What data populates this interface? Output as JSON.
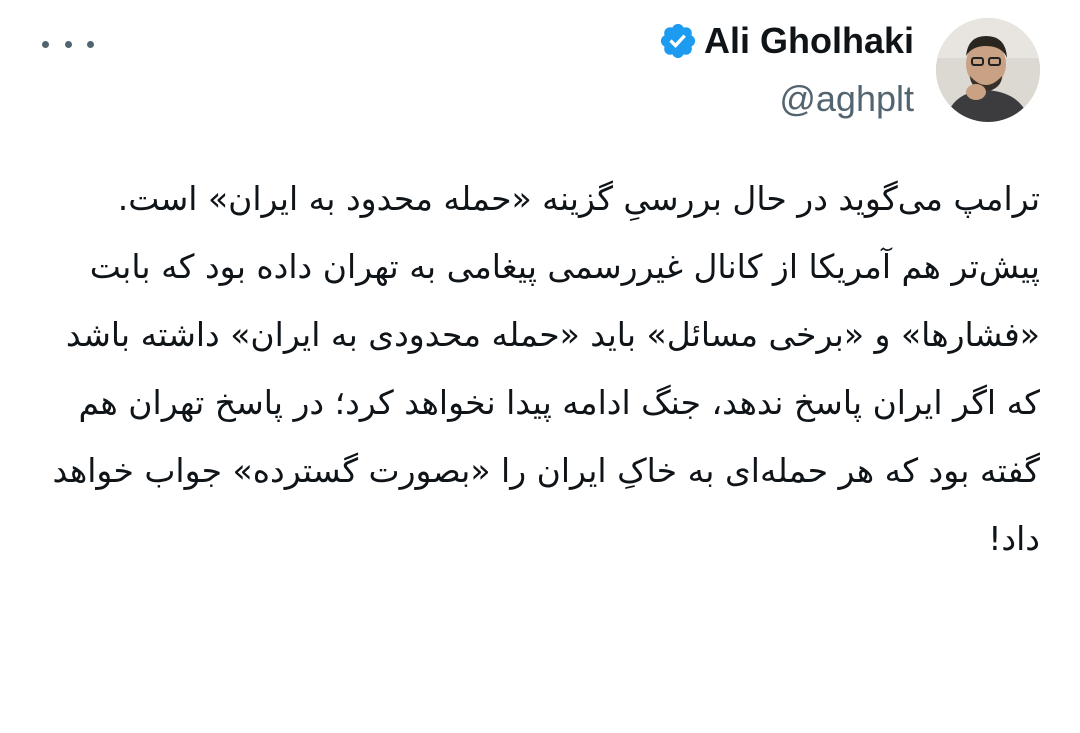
{
  "author": {
    "display_name": "Ali Gholhaki",
    "handle": "@aghplt",
    "verified": true,
    "verified_color": "#1d9bf0"
  },
  "tweet": {
    "paragraph_1": "ترامپ می‌گوید در حال بررسیِ گزینه «حمله محدود به ایران» است.",
    "paragraph_2": "پیش‌تر هم آمریکا از کانال غیررسمی پیغامی به تهران داده بود که بابت «فشارها» و «برخی مسائل» باید «حمله محدودی به ایران» داشته باشد که اگر ایران پاسخ ندهد، جنگ ادامه پیدا نخواهد کرد؛ در پاسخ تهران هم گفته بود که هر حمله‌ای به خاکِ ایران را «بصورت گسترده» جواب خواهد داد!"
  },
  "icons": {
    "more": "more-horizontal-icon",
    "verified": "verified-badge-icon"
  },
  "colors": {
    "text_primary": "#0f1419",
    "text_secondary": "#536471",
    "verified": "#1d9bf0"
  }
}
